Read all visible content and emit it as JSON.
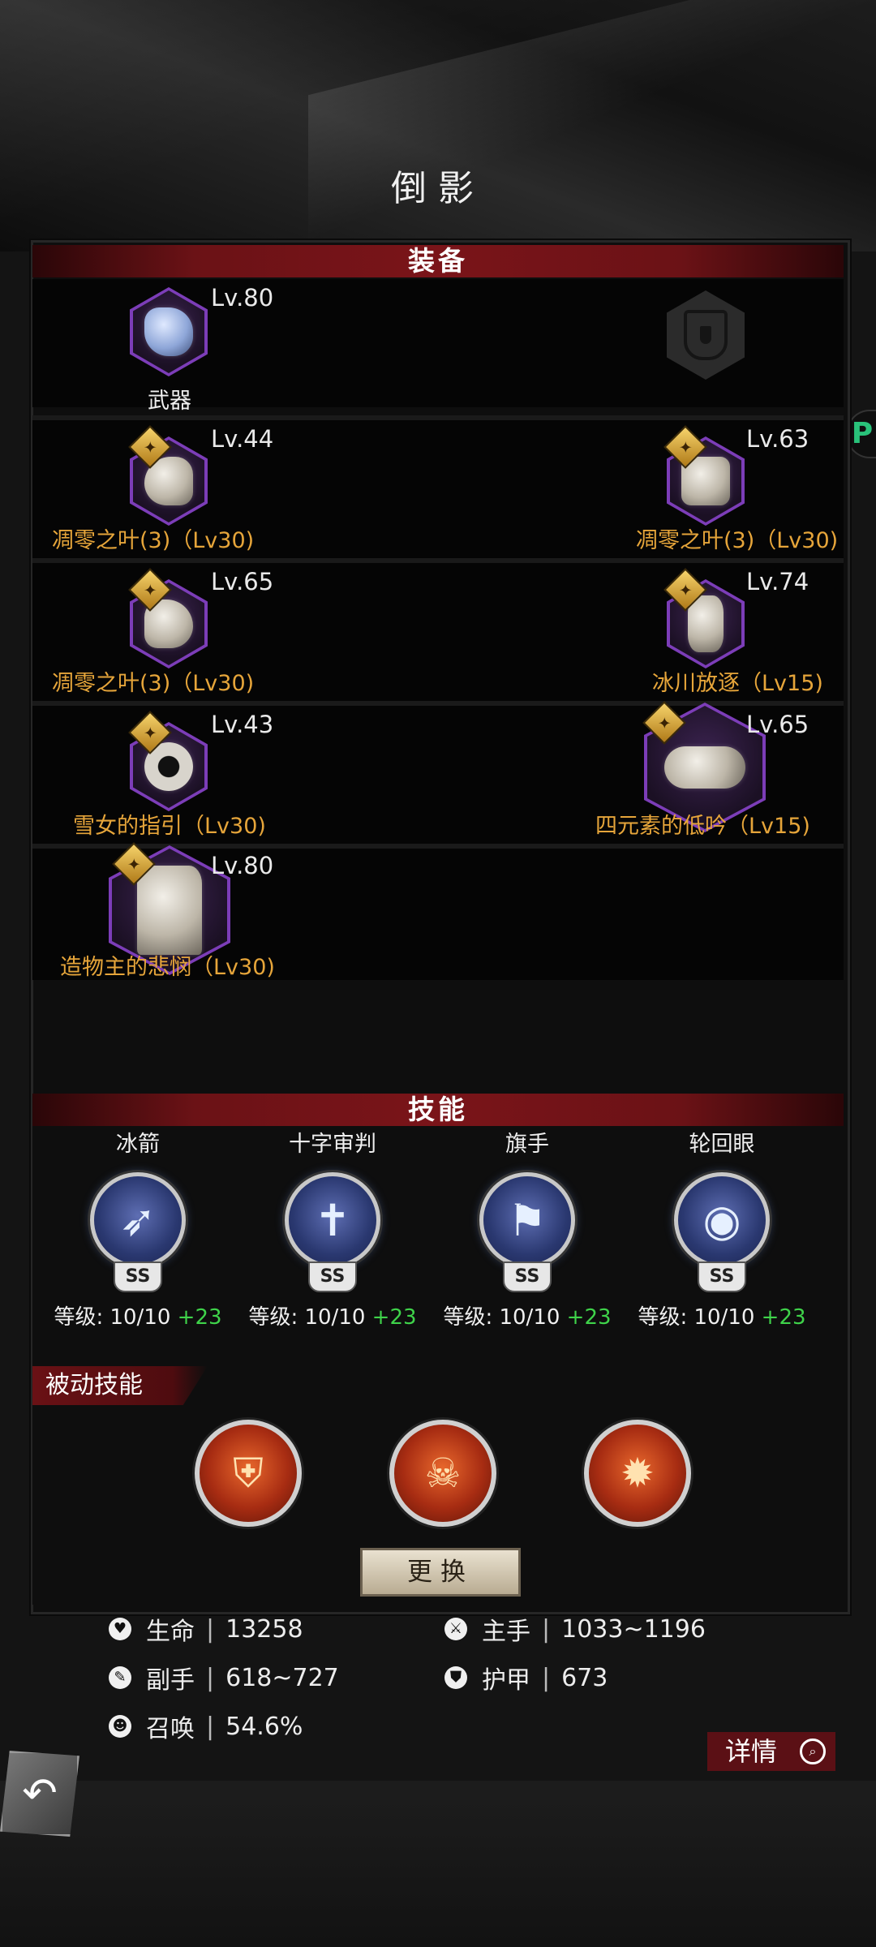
{
  "title": "倒影",
  "equipment": {
    "header": "装备",
    "slots": [
      {
        "level": "Lv.80",
        "name": "武器"
      },
      {
        "level": "Lv.44",
        "name": "凋零之叶(3)（Lv30)"
      },
      {
        "level": "Lv.63",
        "name": "凋零之叶(3)（Lv30)"
      },
      {
        "level": "Lv.65",
        "name": "凋零之叶(3)（Lv30)"
      },
      {
        "level": "Lv.74",
        "name": "冰川放逐（Lv15)"
      },
      {
        "level": "Lv.43",
        "name": "雪女的指引（Lv30)"
      },
      {
        "level": "Lv.65",
        "name": "四元素的低吟（Lv15)"
      },
      {
        "level": "Lv.80",
        "name": "造物主的悲悯（Lv30)"
      }
    ]
  },
  "skills": {
    "header": "技能",
    "items": [
      {
        "name": "冰箭",
        "icon": "ice-arrows-icon",
        "rank": "SS",
        "level_label": "等级: 10/10",
        "bonus": "+23"
      },
      {
        "name": "十字审判",
        "icon": "cross-judgement-icon",
        "rank": "SS",
        "level_label": "等级: 10/10",
        "bonus": "+23"
      },
      {
        "name": "旗手",
        "icon": "banner-flag-icon",
        "rank": "SS",
        "level_label": "等级: 10/10",
        "bonus": "+23"
      },
      {
        "name": "轮回眼",
        "icon": "vortex-eye-icon",
        "rank": "SS",
        "level_label": "等级: 10/10",
        "bonus": "+23"
      }
    ],
    "passive_label": "被动技能",
    "change_button": "更换"
  },
  "stats": {
    "life_label": "生命",
    "life_value": "13258",
    "main_label": "主手",
    "main_value": "1033~1196",
    "off_label": "副手",
    "off_value": "618~727",
    "armor_label": "护甲",
    "armor_value": "673",
    "summon_label": "召唤",
    "summon_value": "54.6%"
  },
  "detail_button": "详情",
  "side_tab": "P",
  "colors": {
    "accent_red": "#6b1216",
    "gold_text": "#e6a53a",
    "bonus_green": "#3fd34a",
    "epic_purple": "#7c3db8"
  }
}
